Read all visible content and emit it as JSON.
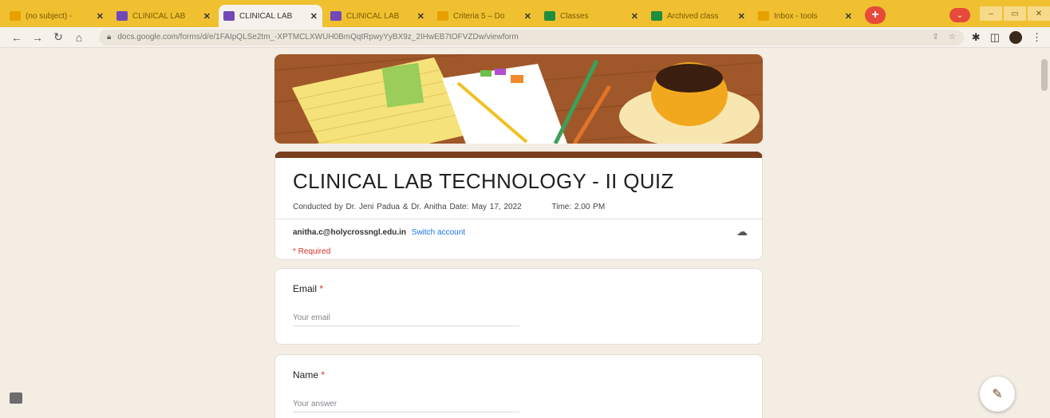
{
  "browser": {
    "tabs": [
      {
        "title": "(no subject) -",
        "icon": "mail-icon",
        "active": false
      },
      {
        "title": "CLINICAL LAB",
        "icon": "forms-icon",
        "active": false
      },
      {
        "title": "CLINICAL LAB",
        "icon": "forms-icon",
        "active": true
      },
      {
        "title": "CLINICAL LAB",
        "icon": "forms-icon",
        "active": false
      },
      {
        "title": "Criteria 5 – Do",
        "icon": "mail-icon",
        "active": false
      },
      {
        "title": "Classes",
        "icon": "classroom-icon",
        "active": false
      },
      {
        "title": "Archived class",
        "icon": "classroom-icon",
        "active": false
      },
      {
        "title": "Inbox - tools",
        "icon": "mail-icon",
        "active": false
      }
    ],
    "new_tab_label": "+",
    "url": "docs.google.com/forms/d/e/1FAIpQLSe2tm_-XPTMCLXWUH0BmQqtRpwyYyBX9z_2IHwEB7tOFVZDw/viewform"
  },
  "form": {
    "title": "CLINICAL LAB TECHNOLOGY - II QUIZ",
    "description": "Conducted by Dr. Jeni Padua & Dr. Anitha   Date: May 17, 2022",
    "time": "Time: 2.00 PM",
    "account_email": "anitha.c@holycrossngl.edu.in",
    "switch_account": "Switch account",
    "required_note": "* Required",
    "questions": [
      {
        "label": "Email",
        "required_mark": "*",
        "placeholder": "Your email"
      },
      {
        "label": "Name",
        "required_mark": "*",
        "placeholder": "Your answer"
      }
    ]
  },
  "colors": {
    "theme_accent": "#7a3e1c",
    "page_bg": "#f3ede4",
    "tabstrip": "#f0c030",
    "required": "#d93025",
    "link": "#1a73e8"
  }
}
